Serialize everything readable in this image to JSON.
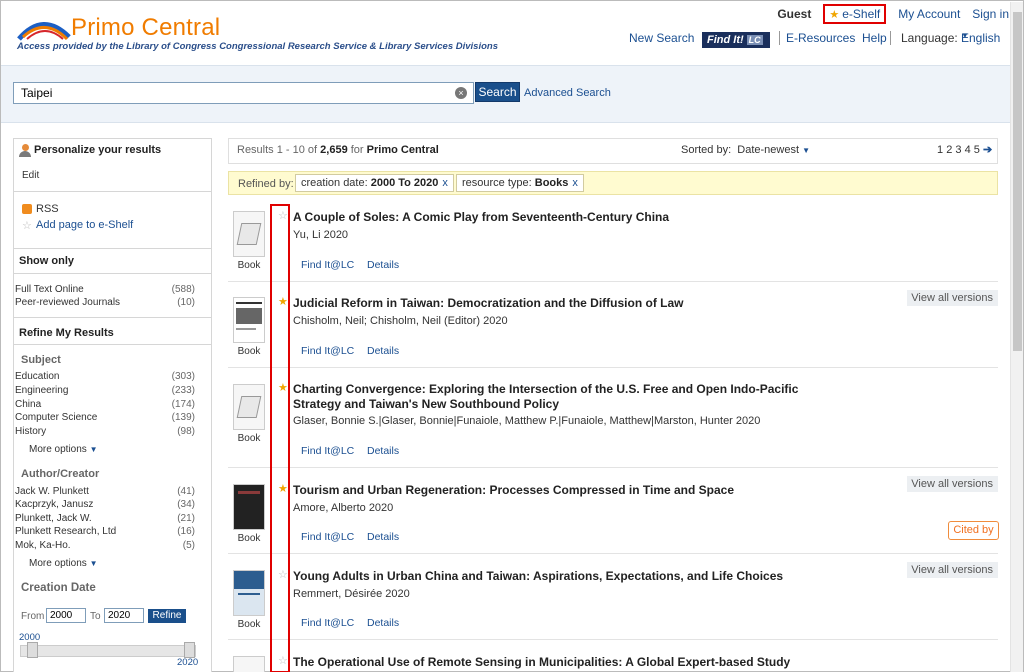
{
  "header": {
    "logo_text": "Primo Central",
    "tagline": "Access provided by the Library of Congress Congressional Research Service & Library Services Divisions",
    "guest": "Guest",
    "eshelf": "e-Shelf",
    "my_account": "My Account",
    "sign_in": "Sign in",
    "nav": {
      "new_search": "New Search",
      "find_it": "Find It!",
      "find_it_badge": "LC",
      "e_resources": "E-Resources",
      "help": "Help",
      "language_label": "Language:",
      "language_value": "English"
    }
  },
  "search": {
    "query": "Taipei",
    "button": "Search",
    "advanced": "Advanced Search"
  },
  "left": {
    "personalize": "Personalize your results",
    "edit": "Edit",
    "rss": "RSS",
    "add_page": "Add page to e-Shelf",
    "show_only": "Show only",
    "show_only_items": [
      {
        "label": "Full Text Online",
        "count": "(588)"
      },
      {
        "label": "Peer-reviewed Journals",
        "count": "(10)"
      }
    ],
    "refine": "Refine My Results",
    "subject_title": "Subject",
    "subject_items": [
      {
        "label": "Education",
        "count": "(303)"
      },
      {
        "label": "Engineering",
        "count": "(233)"
      },
      {
        "label": "China",
        "count": "(174)"
      },
      {
        "label": "Computer Science",
        "count": "(139)"
      },
      {
        "label": "History",
        "count": "(98)"
      }
    ],
    "more_options": "More options",
    "author_title": "Author/Creator",
    "author_items": [
      {
        "label": "Jack W. Plunkett",
        "count": "(41)"
      },
      {
        "label": "Kacprzyk, Janusz",
        "count": "(34)"
      },
      {
        "label": "Plunkett, Jack W.",
        "count": "(21)"
      },
      {
        "label": "Plunkett Research, Ltd",
        "count": "(16)"
      },
      {
        "label": "Mok, Ka-Ho.",
        "count": "(5)"
      }
    ],
    "creation_title": "Creation Date",
    "from_label": "From",
    "from_value": "2000",
    "to_label": "To",
    "to_value": "2020",
    "refine_btn": "Refine",
    "slider_min": "2000",
    "slider_max": "2020"
  },
  "results": {
    "range": "Results 1 - 10 of",
    "total": "2,659",
    "for": "for",
    "scope": "Primo Central",
    "sorted_label": "Sorted by:",
    "sorted_value": "Date-newest",
    "pages": [
      "1",
      "2",
      "3",
      "4",
      "5"
    ],
    "refined_label": "Refined by:",
    "facets": [
      {
        "name": "creation date:",
        "value": "2000 To 2020"
      },
      {
        "name": "resource type:",
        "value": "Books"
      }
    ],
    "find_it": "Find It@LC",
    "details": "Details",
    "view_all": "View all versions",
    "cited_by": "Cited by",
    "items": [
      {
        "title": "A Couple of Soles: A Comic Play from Seventeenth-Century China",
        "author": "Yu, Li 2020",
        "type": "Book",
        "starred": false
      },
      {
        "title": "Judicial Reform in Taiwan: Democratization and the Diffusion of Law",
        "author": "Chisholm, Neil; Chisholm, Neil (Editor) 2020",
        "type": "Book",
        "starred": true
      },
      {
        "title": "Charting Convergence: Exploring the Intersection of the U.S. Free and Open Indo-Pacific Strategy and Taiwan's New Southbound Policy",
        "author": "Glaser, Bonnie S.|Glaser, Bonnie|Funaiole, Matthew P.|Funaiole, Matthew|Marston, Hunter 2020",
        "type": "Book",
        "starred": true
      },
      {
        "title": "Tourism and Urban Regeneration: Processes Compressed in Time and Space",
        "author": "Amore, Alberto 2020",
        "type": "Book",
        "starred": true
      },
      {
        "title": "Young Adults in Urban China and Taiwan: Aspirations, Expectations, and Life Choices",
        "author": "Remmert, Désirée 2020",
        "type": "Book",
        "starred": false
      },
      {
        "title": "The Operational Use of Remote Sensing in Municipalities: A Global Expert-based Study",
        "author": "",
        "type": "",
        "starred": false
      }
    ]
  },
  "colors": {
    "accent": "#1b4f91",
    "brand": "#f07c00",
    "highlight": "#e00000"
  }
}
